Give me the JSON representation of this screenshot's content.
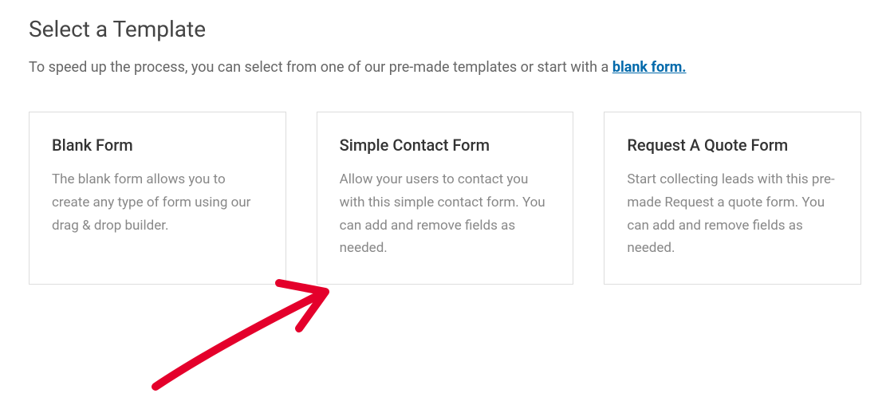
{
  "header": {
    "title": "Select a Template",
    "intro_prefix": "To speed up the process, you can select from one of our pre-made templates or start with a ",
    "intro_link": "blank form."
  },
  "templates": [
    {
      "title": "Blank Form",
      "description": "The blank form allows you to create any type of form using our drag & drop builder."
    },
    {
      "title": "Simple Contact Form",
      "description": "Allow your users to contact you with this simple contact form. You can add and remove fields as needed."
    },
    {
      "title": "Request A Quote Form",
      "description": "Start collecting leads with this pre-made Request a quote form. You can add and remove fields as needed."
    }
  ]
}
